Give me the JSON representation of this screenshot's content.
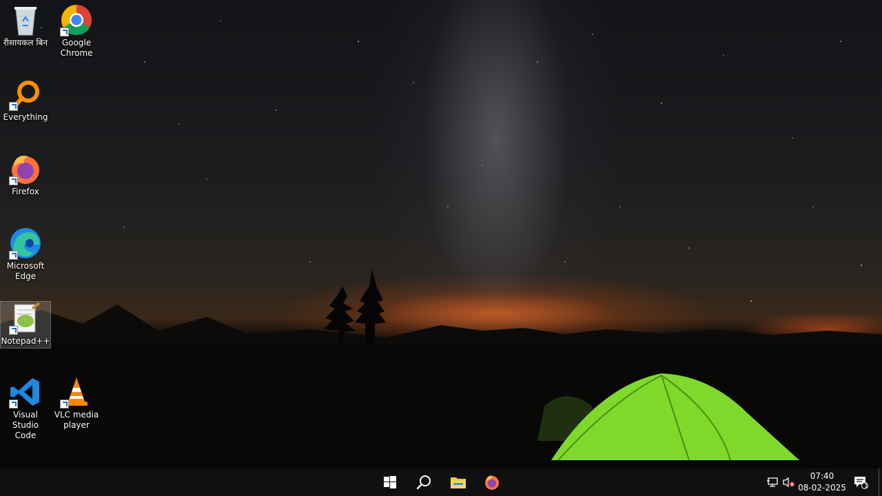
{
  "desktop": {
    "icons": [
      {
        "label_line1": "रीसायकल बिन",
        "label_line2": ""
      },
      {
        "label_line1": "Google",
        "label_line2": "Chrome"
      },
      {
        "label_line1": "Everything",
        "label_line2": ""
      },
      {
        "label_line1": "Firefox",
        "label_line2": ""
      },
      {
        "label_line1": "Microsoft",
        "label_line2": "Edge"
      },
      {
        "label_line1": "Notepad++",
        "label_line2": ""
      },
      {
        "label_line1": "Visual Studio",
        "label_line2": "Code"
      },
      {
        "label_line1": "VLC media",
        "label_line2": "player"
      }
    ]
  },
  "taskbar": {
    "pinned": [
      "windows-start-icon",
      "search-icon",
      "file-explorer-icon",
      "firefox-icon"
    ],
    "clock": {
      "time": "07:40",
      "date": "08-02-2025"
    },
    "notification_count": "1"
  },
  "colors": {
    "taskbar": "#101010",
    "tent": "#7fd92a"
  }
}
